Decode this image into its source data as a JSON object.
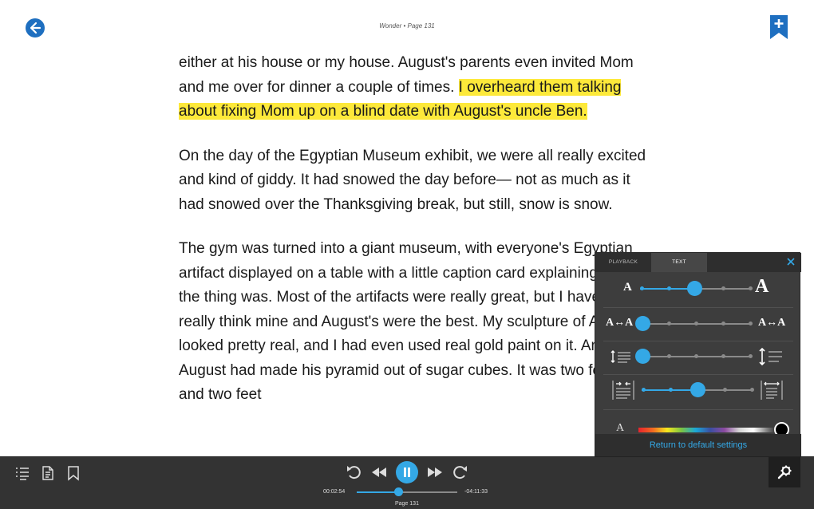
{
  "header": {
    "book_title": "Wonder • Page 131",
    "back_icon": "arrow-left-circle-icon",
    "bookmark_icon": "bookmark-add-icon",
    "accent_color": "#1e6fc0"
  },
  "reading": {
    "paragraphs": [
      {
        "before": "either at his house or my house. August's parents even invited Mom and me over for dinner a couple of times. ",
        "highlight": "I overheard them talking about fixing Mom up on a blind date with August's uncle Ben.",
        "after": ""
      },
      {
        "text": "On the day of the Egyptian Museum exhibit, we were all really excited and kind of giddy. It had snowed the day before— not as much as it had snowed over the Thanksgiving break, but still, snow is snow."
      },
      {
        "text": "The gym was turned into a giant museum, with everyone's Egyptian artifact displayed on a table with a little caption card explaining what the thing was. Most of the artifacts were really great, but I have to say I really think mine and August's were the best. My sculpture of Anubis looked pretty real, and I had even used real gold paint on it. And August had made his pyramid out of sugar cubes. It was two feet high and two feet"
      }
    ],
    "highlight_color": "#fde93a"
  },
  "settings_panel": {
    "tabs": [
      {
        "label": "PLAYBACK",
        "active": false
      },
      {
        "label": "TEXT",
        "active": true
      }
    ],
    "font_size": {
      "min_glyph": "A",
      "max_glyph": "A",
      "level": 3,
      "steps": 5
    },
    "letter_spacing": {
      "min_glyph": "A↔A",
      "max_glyph": "A↔A",
      "level": 0,
      "steps": 5
    },
    "line_spacing": {
      "level": 0,
      "steps": 5
    },
    "margins": {
      "level": 2,
      "steps": 5
    },
    "text_color": {
      "glyph": "A",
      "selected": "#000000"
    },
    "reset_label": "Return to default settings",
    "accent_color": "#34a8e6"
  },
  "player": {
    "elapsed": "00:02:54",
    "remaining": "-04:11:33",
    "progress": 0.41,
    "page_label": "Page 131"
  }
}
